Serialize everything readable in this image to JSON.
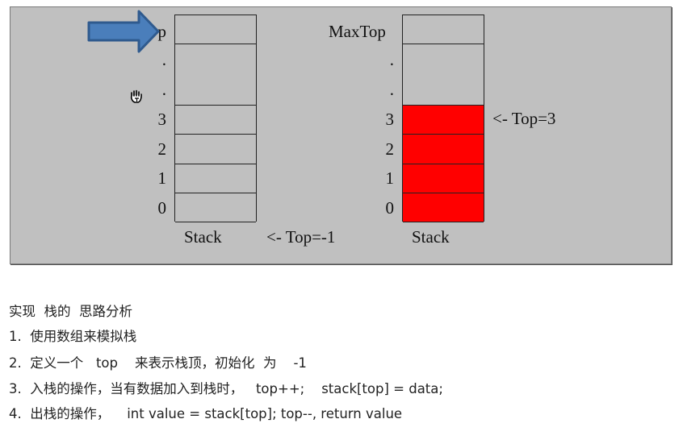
{
  "diagram": {
    "left_stack": {
      "index_labels": [
        "p",
        ".",
        ".",
        "3",
        "2",
        "1",
        "0"
      ],
      "caption": "Stack",
      "pointer_label": "<- Top=-1",
      "filled_cells": 0
    },
    "right_stack": {
      "index_labels": [
        "MaxTop",
        ".",
        ".",
        "3",
        "2",
        "1",
        "0"
      ],
      "caption": "Stack",
      "pointer_label": "<- Top=3",
      "filled_cells": 4,
      "fill_color": "#ff0000"
    },
    "arrow_color": "#4a7ebb",
    "panel_color": "#c0c0c0"
  },
  "notes": {
    "title": "实现  栈的  思路分析",
    "lines": [
      "1.  使用数组来模拟栈",
      "2.  定义一个   top    来表示栈顶，初始化  为    -1",
      "3.  入栈的操作，当有数据加入到栈时，   top++;    stack[top] = data;",
      "4.  出栈的操作，    int value = stack[top]; top--, return value"
    ]
  }
}
